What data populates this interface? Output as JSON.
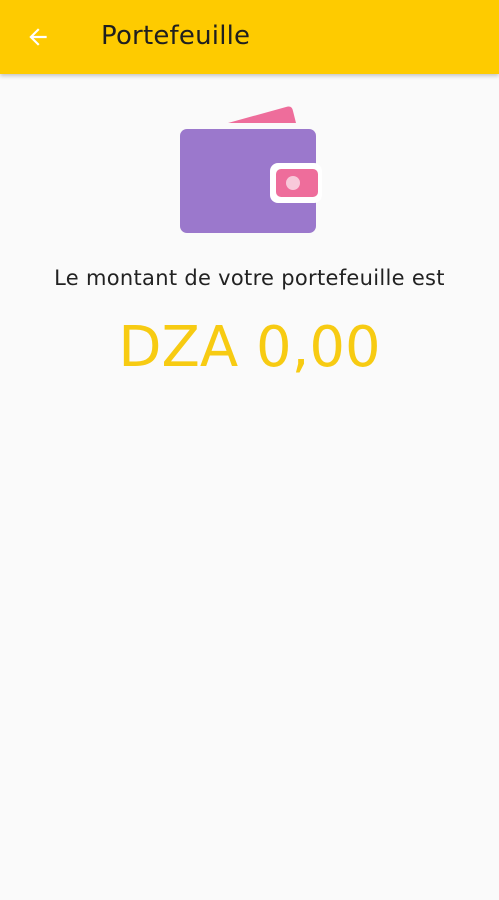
{
  "header": {
    "back_icon": "arrow-left-icon",
    "title": "Portefeuille"
  },
  "wallet": {
    "icon": "wallet-icon",
    "label": "Le montant de votre portefeuille est",
    "amount": "DZA 0,00"
  },
  "colors": {
    "app_bar": "#fecb00",
    "amount": "#f7cb12",
    "wallet_body": "#9b78cc",
    "wallet_card": "#ee6d9b",
    "background": "#fafafa"
  }
}
